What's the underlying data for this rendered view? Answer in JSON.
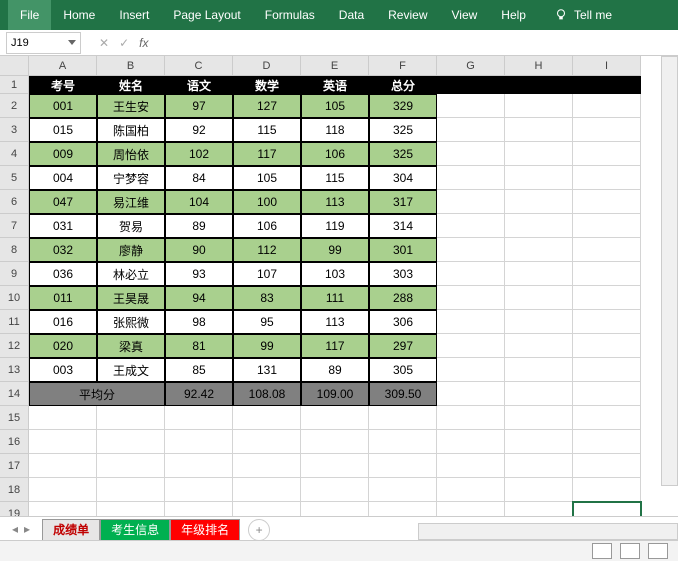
{
  "ribbon": {
    "items": [
      "File",
      "Home",
      "Insert",
      "Page Layout",
      "Formulas",
      "Data",
      "Review",
      "View",
      "Help"
    ],
    "tellme": "Tell me"
  },
  "nameBox": "J19",
  "columns": [
    "A",
    "B",
    "C",
    "D",
    "E",
    "F",
    "G",
    "H",
    "I"
  ],
  "rowCount": 19,
  "header": [
    "考号",
    "姓名",
    "语文",
    "数学",
    "英语",
    "总分"
  ],
  "rows": [
    [
      "001",
      "王生安",
      "97",
      "127",
      "105",
      "329"
    ],
    [
      "015",
      "陈国柏",
      "92",
      "115",
      "118",
      "325"
    ],
    [
      "009",
      "周怡依",
      "102",
      "117",
      "106",
      "325"
    ],
    [
      "004",
      "宁梦容",
      "84",
      "105",
      "115",
      "304"
    ],
    [
      "047",
      "易江维",
      "104",
      "100",
      "113",
      "317"
    ],
    [
      "031",
      "贺易",
      "89",
      "106",
      "119",
      "314"
    ],
    [
      "032",
      "廖静",
      "90",
      "112",
      "99",
      "301"
    ],
    [
      "036",
      "林必立",
      "93",
      "107",
      "103",
      "303"
    ],
    [
      "011",
      "王昊晟",
      "94",
      "83",
      "111",
      "288"
    ],
    [
      "016",
      "张熙微",
      "98",
      "95",
      "113",
      "306"
    ],
    [
      "020",
      "梁真",
      "81",
      "99",
      "117",
      "297"
    ],
    [
      "003",
      "王成文",
      "85",
      "131",
      "89",
      "305"
    ]
  ],
  "avg": {
    "label": "平均分",
    "values": [
      "92.42",
      "108.08",
      "109.00",
      "309.50"
    ]
  },
  "tabs": [
    "成绩单",
    "考生信息",
    "年级排名"
  ],
  "chart_data": {
    "type": "table",
    "title": "成绩单",
    "columns": [
      "考号",
      "姓名",
      "语文",
      "数学",
      "英语",
      "总分"
    ],
    "rows": [
      [
        "001",
        "王生安",
        97,
        127,
        105,
        329
      ],
      [
        "015",
        "陈国柏",
        92,
        115,
        118,
        325
      ],
      [
        "009",
        "周怡依",
        102,
        117,
        106,
        325
      ],
      [
        "004",
        "宁梦容",
        84,
        105,
        115,
        304
      ],
      [
        "047",
        "易江维",
        104,
        100,
        113,
        317
      ],
      [
        "031",
        "贺易",
        89,
        106,
        119,
        314
      ],
      [
        "032",
        "廖静",
        90,
        112,
        99,
        301
      ],
      [
        "036",
        "林必立",
        93,
        107,
        103,
        303
      ],
      [
        "011",
        "王昊晟",
        94,
        83,
        111,
        288
      ],
      [
        "016",
        "张熙微",
        98,
        95,
        113,
        306
      ],
      [
        "020",
        "梁真",
        81,
        99,
        117,
        297
      ],
      [
        "003",
        "王成文",
        85,
        131,
        89,
        305
      ]
    ],
    "summary": {
      "label": "平均分",
      "values": [
        92.42,
        108.08,
        109.0,
        309.5
      ]
    }
  }
}
